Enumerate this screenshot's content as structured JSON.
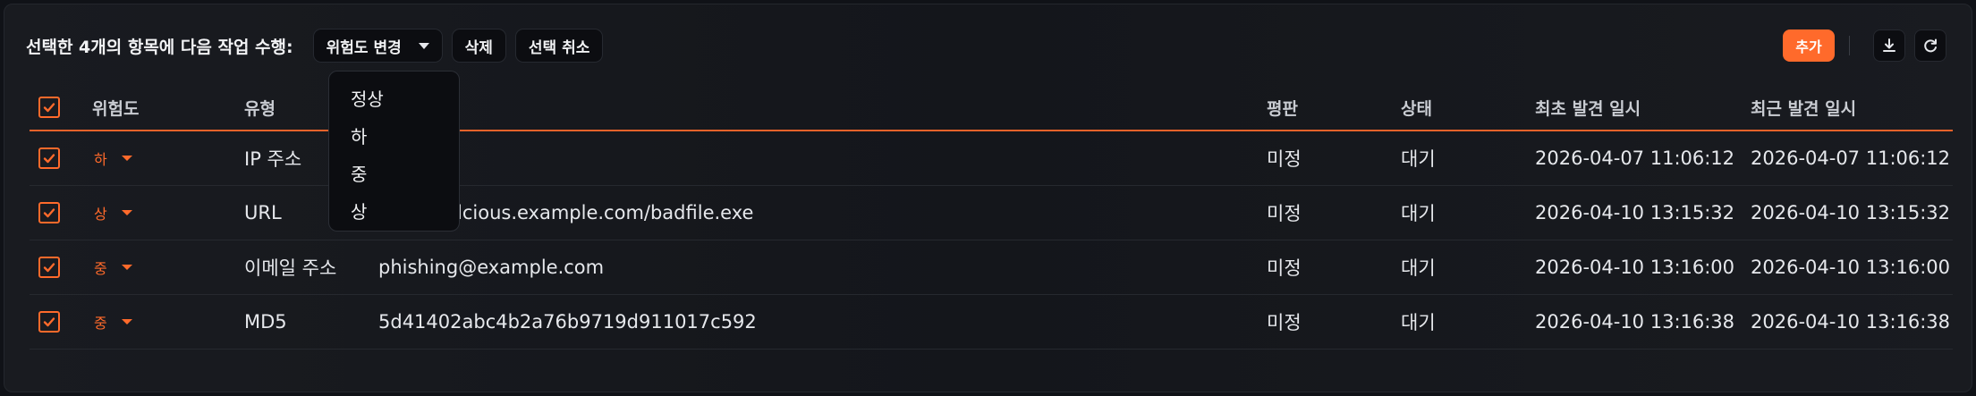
{
  "toolbar": {
    "bulk_label": "선택한 4개의 항목에 다음 작업 수행:",
    "risk_dropdown_label": "위험도 변경",
    "delete_label": "삭제",
    "deselect_label": "선택 취소",
    "add_label": "추가"
  },
  "table": {
    "headers": {
      "risk": "위험도",
      "type": "유형",
      "reputation": "평판",
      "status": "상태",
      "first_seen": "최초 발견 일시",
      "last_seen": "최근 발견 일시"
    },
    "rows": [
      {
        "risk": "하",
        "type": "IP 주소",
        "value": "",
        "reputation": "미정",
        "status": "대기",
        "first_seen": "2026-04-07 11:06:12",
        "last_seen": "2026-04-07 11:06:12"
      },
      {
        "risk": "상",
        "type": "URL",
        "value": "lcious.example.com/badfile.exe",
        "reputation": "미정",
        "status": "대기",
        "first_seen": "2026-04-10 13:15:32",
        "last_seen": "2026-04-10 13:15:32"
      },
      {
        "risk": "중",
        "type": "이메일 주소",
        "value": "phishing@example.com",
        "reputation": "미정",
        "status": "대기",
        "first_seen": "2026-04-10 13:16:00",
        "last_seen": "2026-04-10 13:16:00"
      },
      {
        "risk": "중",
        "type": "MD5",
        "value": "5d41402abc4b2a76b9719d911017c592",
        "reputation": "미정",
        "status": "대기",
        "first_seen": "2026-04-10 13:16:38",
        "last_seen": "2026-04-10 13:16:38"
      }
    ]
  },
  "risk_menu": {
    "options": [
      "정상",
      "하",
      "중",
      "상"
    ]
  },
  "colors": {
    "accent": "#ff6a2b",
    "background": "#14161b"
  },
  "icons": {
    "checkbox": "checkbox-checked-icon",
    "download": "download-icon",
    "refresh": "refresh-icon",
    "dropdown": "caret-down-icon"
  }
}
